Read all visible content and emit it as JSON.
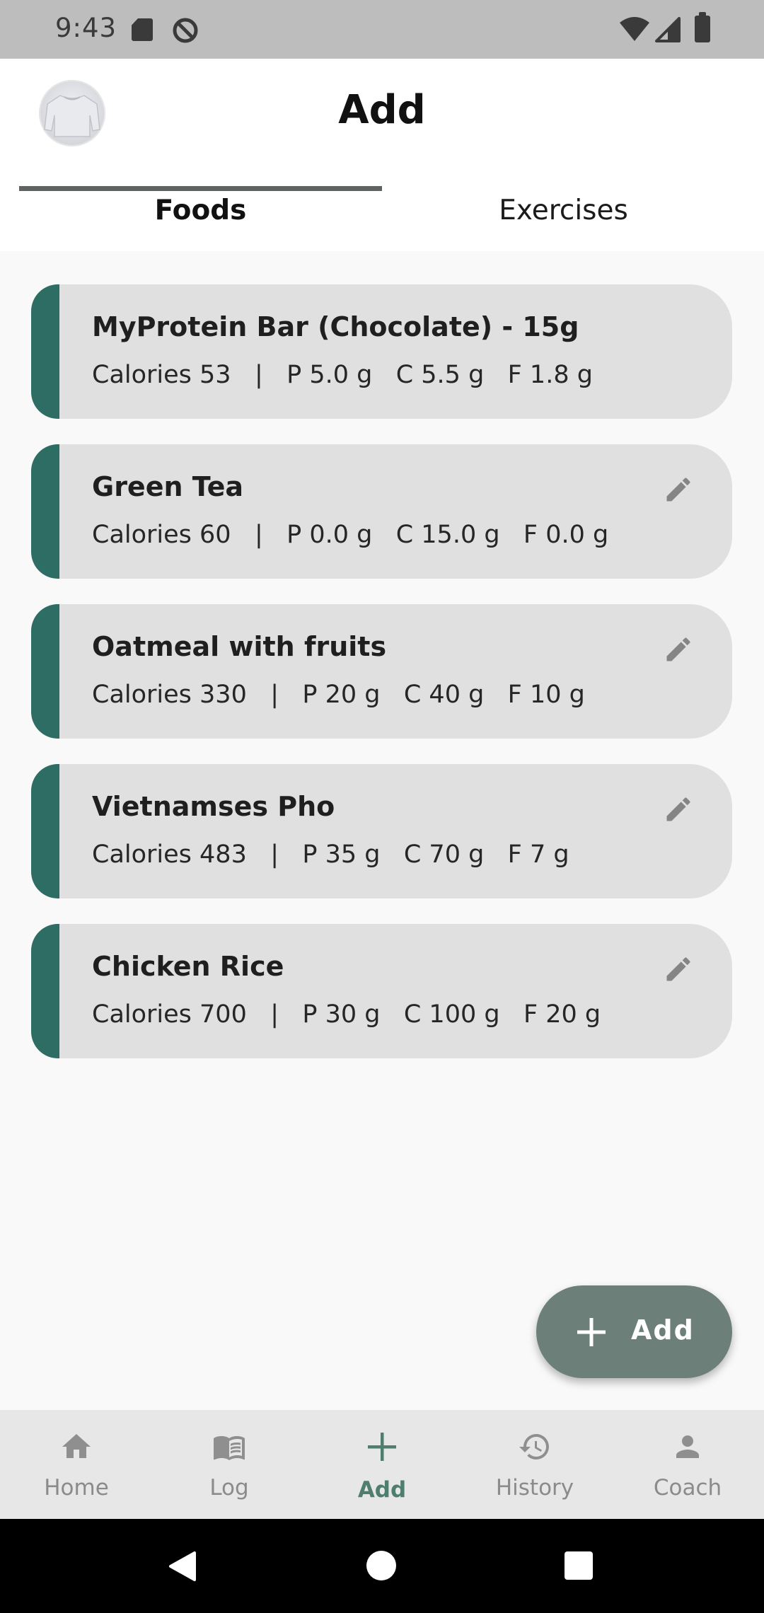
{
  "status_bar": {
    "time": "9:43"
  },
  "header": {
    "title": "Add",
    "avatar_icon": "sweater-avatar"
  },
  "tabs": [
    {
      "label": "Foods",
      "selected": true
    },
    {
      "label": "Exercises",
      "selected": false
    }
  ],
  "foods": [
    {
      "name": "MyProtein Bar (Chocolate) - 15g",
      "macros": "Calories 53   |   P 5.0 g   C 5.5 g   F 1.8 g",
      "editable": false
    },
    {
      "name": "Green Tea",
      "macros": "Calories 60   |   P 0.0 g   C 15.0 g   F 0.0 g",
      "editable": true
    },
    {
      "name": "Oatmeal with fruits",
      "macros": "Calories 330   |   P 20 g   C 40 g   F 10 g",
      "editable": true
    },
    {
      "name": "Vietnamses Pho",
      "macros": "Calories 483   |   P 35 g   C 70 g   F 7 g",
      "editable": true
    },
    {
      "name": "Chicken Rice",
      "macros": "Calories 700   |   P 30 g   C 100 g   F 20 g",
      "editable": true
    }
  ],
  "fab": {
    "label": "Add",
    "icon": "plus-icon"
  },
  "bottom_nav": [
    {
      "label": "Home",
      "icon": "home-icon",
      "active": false
    },
    {
      "label": "Log",
      "icon": "book-icon",
      "active": false
    },
    {
      "label": "Add",
      "icon": "plus-icon",
      "active": true
    },
    {
      "label": "History",
      "icon": "history-icon",
      "active": false
    },
    {
      "label": "Coach",
      "icon": "person-icon",
      "active": false
    }
  ],
  "colors": {
    "accent": "#2e6d63",
    "fab": "#6c7f79",
    "active_nav": "#4f7d6e",
    "card": "#e0e0e0"
  }
}
